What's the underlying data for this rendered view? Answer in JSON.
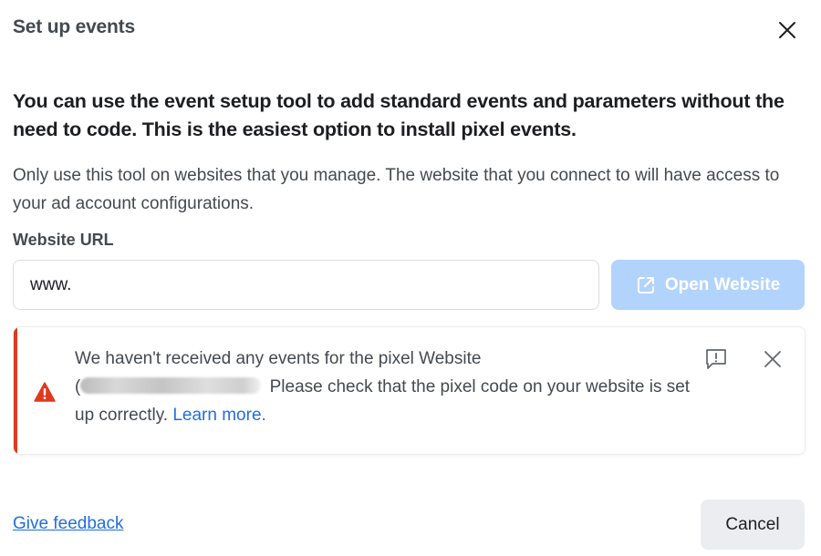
{
  "dialog": {
    "title": "Set up events",
    "close_icon": "close-icon"
  },
  "content": {
    "headline": "You can use the event setup tool to add standard events and parameters without the need to code. This is the easiest option to install pixel events.",
    "description": "Only use this tool on websites that you manage. The website that you connect to will have access to your ad account configurations."
  },
  "url_field": {
    "label": "Website URL",
    "value": "www.",
    "placeholder": ""
  },
  "open_website_button": {
    "label": "Open Website",
    "icon": "external-link-icon",
    "disabled": true
  },
  "alert": {
    "type": "error",
    "icon": "warning-triangle-icon",
    "text_part1": "We haven't received any events for the pixel Website",
    "redacted_open_paren": "(",
    "text_part2": "Please check that the pixel code on your website is set up correctly.",
    "link_label": "Learn more.",
    "feedback_icon": "report-feedback-icon",
    "dismiss_icon": "close-icon"
  },
  "footer": {
    "feedback_link": "Give feedback",
    "cancel_label": "Cancel"
  },
  "colors": {
    "accent_blue": "#216fdb",
    "disabled_button": "#b2d3fb",
    "error_red": "#e0391f",
    "secondary_button": "#ebedf0"
  }
}
